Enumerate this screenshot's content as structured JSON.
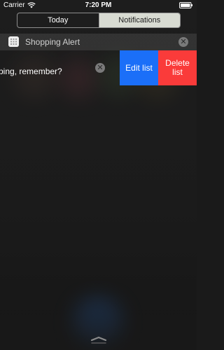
{
  "status_bar": {
    "carrier": "Carrier",
    "time": "7:20 PM",
    "wifi_icon": "wifi-icon",
    "battery_icon": "battery-icon"
  },
  "tabs": {
    "today": "Today",
    "notifications": "Notifications",
    "selected": "notifications"
  },
  "notification_group": {
    "app_name": "Shopping Alert",
    "app_icon": "calendar-grid-icon",
    "close_icon": "close-icon"
  },
  "notification": {
    "text": "ping, remember?",
    "clear_icon": "close-icon"
  },
  "actions": {
    "edit_list": "Edit list",
    "delete_list": "Delete\nlist"
  },
  "colors": {
    "edit_action": "#1b6ff8",
    "delete_action": "#fa3b3a",
    "selected_tab": "#d8dbd2"
  },
  "bottom": {
    "grabber_icon": "chevron-up-grabber-icon"
  }
}
